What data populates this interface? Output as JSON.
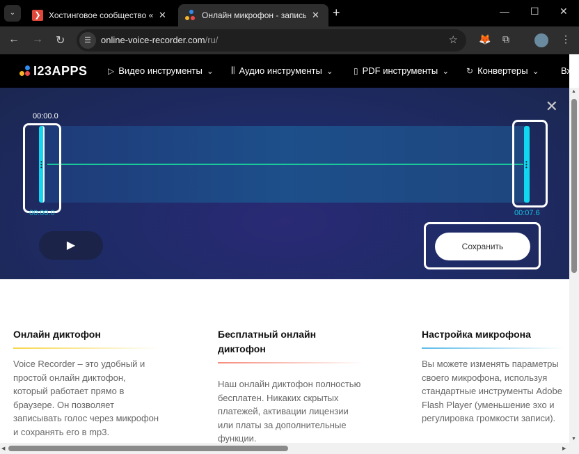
{
  "browser": {
    "tabs": [
      {
        "title": "Хостинговое сообщество «Timeweb»"
      },
      {
        "title": "Онлайн микрофон - запись голоса"
      }
    ],
    "url_host": "online-voice-recorder.com",
    "url_path": "/ru/"
  },
  "site": {
    "logo": "I23APPS",
    "menu": [
      {
        "label": "Видео инструменты"
      },
      {
        "label": "Аудио инструменты"
      },
      {
        "label": "PDF инструменты"
      },
      {
        "label": "Конвертеры"
      },
      {
        "label": "Вх"
      }
    ]
  },
  "editor": {
    "start_time_top": "00:00.0",
    "start_time_bottom": "00:00.0",
    "end_time": "00:07.6",
    "save_label": "Сохранить"
  },
  "columns": [
    {
      "title": "Онлайн диктофон",
      "text": "Voice Recorder – это удобный и простой онлайн диктофон, который работает прямо в браузере. Он позволяет записывать голос через микрофон и сохранять его в mp3.",
      "accent": "#f7d64a"
    },
    {
      "title": "Бесплатный онлайн диктофон",
      "text": "Наш онлайн диктофон полностью бесплатен. Никаких скрытых платежей, активации лицензии или платы за дополнительные функции.",
      "accent": "#f58a7a"
    },
    {
      "title": "Настройка микрофона",
      "text": "Вы можете изменять параметры своего микрофона, используя стандартные инструменты Adobe Flash Player (уменьшение эхо и регулировка громкости записи).",
      "accent": "#5bbbe8"
    }
  ]
}
